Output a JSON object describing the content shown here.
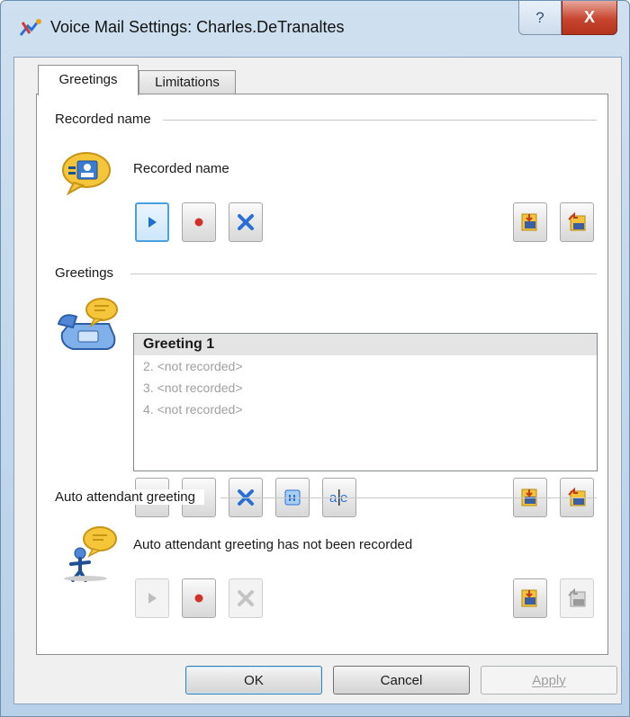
{
  "window": {
    "title": "Voice Mail Settings: Charles.DeTranaltes",
    "help_glyph": "?",
    "close_glyph": "X"
  },
  "tabs": [
    {
      "label": "Greetings",
      "active": true
    },
    {
      "label": "Limitations",
      "active": false
    }
  ],
  "recorded_name": {
    "group_label": "Recorded name",
    "status": "Recorded name",
    "icon": "contact-speech-bubble-icon"
  },
  "greetings": {
    "group_label": "Greetings",
    "icon": "telephone-speech-bubble-icon",
    "items": [
      {
        "label": "Greeting 1",
        "selected": true
      },
      {
        "label": "2. <not recorded>",
        "selected": false
      },
      {
        "label": "3. <not recorded>",
        "selected": false
      },
      {
        "label": "4. <not recorded>",
        "selected": false
      }
    ]
  },
  "auto_attendant": {
    "group_label": "Auto attendant greeting",
    "status": "Auto attendant greeting has not been recorded",
    "icon": "person-speech-bubble-icon"
  },
  "dialog_buttons": {
    "ok": "OK",
    "cancel": "Cancel",
    "apply": "Apply"
  },
  "colors": {
    "play_blue": "#1f6fd0",
    "record_red": "#d0312d",
    "accent_blue": "#4d9fe0",
    "disabled_gray": "#a0a0a0"
  }
}
